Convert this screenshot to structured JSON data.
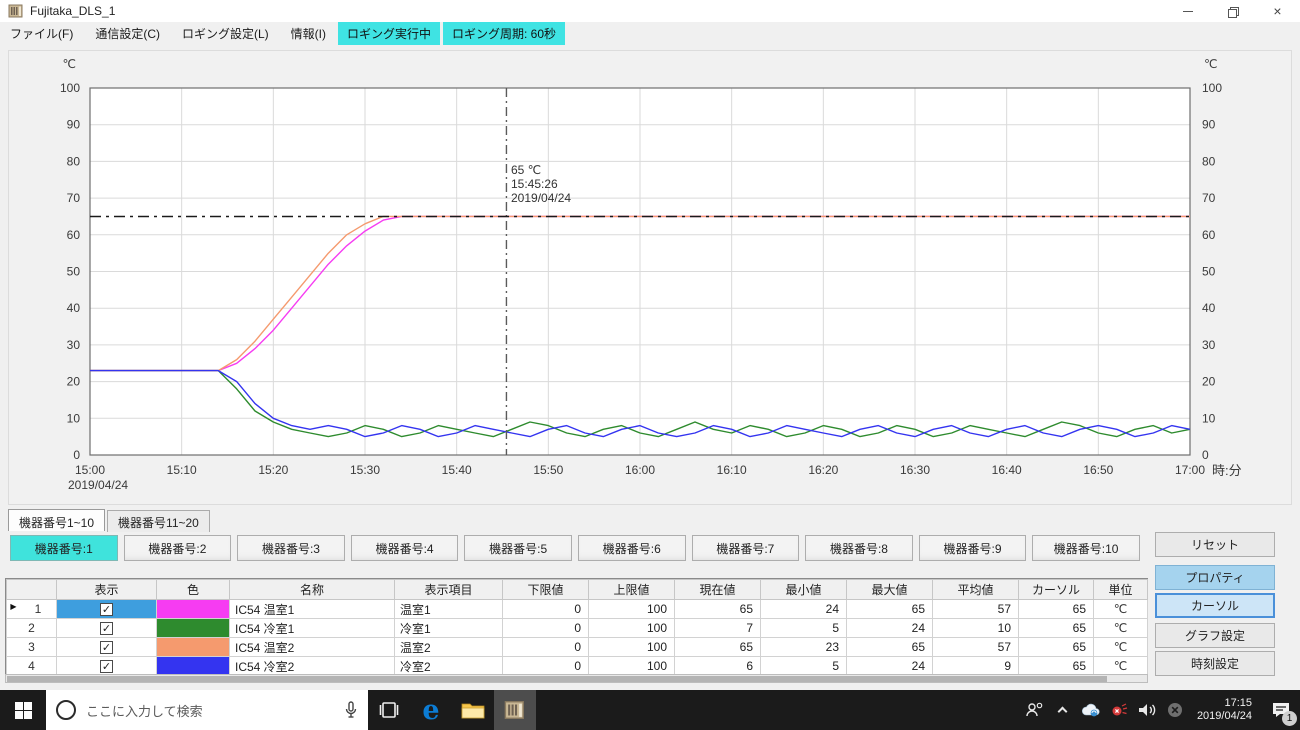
{
  "window": {
    "title": "Fujitaka_DLS_1",
    "controls": [
      "minimize",
      "restore",
      "close"
    ]
  },
  "menu": {
    "items": [
      "ファイル(F)",
      "通信設定(C)",
      "ロギング設定(L)",
      "情報(I)"
    ],
    "status_items": [
      "ロギング実行中",
      "ロギング周期: 60秒"
    ],
    "status_color": "#3fe3e3"
  },
  "chart_data": {
    "type": "line",
    "y_unit_left": "℃",
    "y_unit_right": "℃",
    "xlabel": "時:分",
    "x_date_label": "2019/04/24",
    "ylim": [
      0,
      100
    ],
    "yticks": [
      0,
      10,
      20,
      30,
      40,
      50,
      60,
      70,
      80,
      90,
      100
    ],
    "xtick_minutes": [
      0,
      10,
      20,
      30,
      40,
      50,
      60,
      70,
      80,
      90,
      100,
      110,
      120
    ],
    "xtick_labels": [
      "15:00",
      "15:10",
      "15:20",
      "15:30",
      "15:40",
      "15:50",
      "16:00",
      "16:10",
      "16:20",
      "16:30",
      "16:40",
      "16:50",
      "17:00"
    ],
    "grid": true,
    "x_step_minutes": 2,
    "cursor": {
      "minutes": 45.43,
      "y_value": 65,
      "value_label": "65 ℃",
      "time_label": "15:45:26",
      "date_label": "2019/04/24"
    },
    "series": [
      {
        "name": "IC54 温室1",
        "color": "#f63cf2",
        "values": [
          23,
          23,
          23,
          23,
          23,
          23,
          23,
          23,
          25,
          29,
          34,
          40,
          46,
          52,
          57,
          61,
          64,
          65,
          65,
          65,
          65,
          65,
          65,
          65,
          65,
          65,
          65,
          65,
          65,
          65,
          65,
          65,
          65,
          65,
          65,
          65,
          65,
          65,
          65,
          65,
          65,
          65,
          65,
          65,
          65,
          65,
          65,
          65,
          65,
          65,
          65,
          65,
          65,
          65,
          65,
          65,
          65,
          65,
          65,
          65,
          65
        ]
      },
      {
        "name": "IC54 冷室1",
        "color": "#2e8b2e",
        "values": [
          23,
          23,
          23,
          23,
          23,
          23,
          23,
          23,
          18,
          12,
          9,
          7,
          6,
          5,
          6,
          8,
          7,
          5,
          6,
          8,
          7,
          6,
          5,
          7,
          9,
          8,
          6,
          5,
          7,
          8,
          6,
          5,
          7,
          9,
          7,
          6,
          8,
          7,
          5,
          6,
          8,
          7,
          5,
          6,
          8,
          7,
          5,
          6,
          8,
          7,
          6,
          5,
          7,
          9,
          8,
          6,
          5,
          7,
          8,
          6,
          7
        ]
      },
      {
        "name": "IC54 温室2",
        "color": "#f59a6e",
        "values": [
          23,
          23,
          23,
          23,
          23,
          23,
          23,
          23,
          26,
          31,
          37,
          43,
          49,
          55,
          60,
          63,
          65,
          65,
          65,
          65,
          65,
          65,
          65,
          65,
          65,
          65,
          65,
          65,
          65,
          65,
          65,
          65,
          65,
          65,
          65,
          65,
          65,
          65,
          65,
          65,
          65,
          65,
          65,
          65,
          65,
          65,
          65,
          65,
          65,
          65,
          65,
          65,
          65,
          65,
          65,
          65,
          65,
          65,
          65,
          65,
          65
        ]
      },
      {
        "name": "IC54 冷室2",
        "color": "#3434f0",
        "values": [
          23,
          23,
          23,
          23,
          23,
          23,
          23,
          23,
          20,
          14,
          10,
          8,
          7,
          8,
          7,
          5,
          6,
          8,
          7,
          5,
          6,
          8,
          7,
          6,
          5,
          7,
          8,
          6,
          5,
          7,
          8,
          6,
          5,
          6,
          8,
          7,
          5,
          6,
          8,
          7,
          6,
          5,
          7,
          8,
          6,
          5,
          7,
          8,
          6,
          5,
          7,
          8,
          6,
          5,
          7,
          8,
          7,
          5,
          6,
          8,
          7
        ]
      }
    ]
  },
  "tabs": [
    {
      "label": "機器番号1~10",
      "active": true
    },
    {
      "label": "機器番号11~20",
      "active": false
    }
  ],
  "device_buttons": [
    {
      "label": "機器番号:1",
      "active": true
    },
    {
      "label": "機器番号:2",
      "active": false
    },
    {
      "label": "機器番号:3",
      "active": false
    },
    {
      "label": "機器番号:4",
      "active": false
    },
    {
      "label": "機器番号:5",
      "active": false
    },
    {
      "label": "機器番号:6",
      "active": false
    },
    {
      "label": "機器番号:7",
      "active": false
    },
    {
      "label": "機器番号:8",
      "active": false
    },
    {
      "label": "機器番号:9",
      "active": false
    },
    {
      "label": "機器番号:10",
      "active": false
    }
  ],
  "side_buttons": [
    {
      "label": "リセット",
      "variant": "default"
    },
    {
      "label": "プロパティ",
      "variant": "hover"
    },
    {
      "label": "カーソル",
      "variant": "active"
    },
    {
      "label": "グラフ設定",
      "variant": "default"
    },
    {
      "label": "時刻設定",
      "variant": "default"
    }
  ],
  "table": {
    "headers": [
      "表示",
      "色",
      "名称",
      "表示項目",
      "下限値",
      "上限値",
      "現在値",
      "最小値",
      "最大値",
      "平均値",
      "カーソル",
      "単位"
    ],
    "rows": [
      {
        "no": "1",
        "selected": true,
        "checked": true,
        "color": "#f63cf2",
        "name": "IC54 温室1",
        "item": "温室1",
        "lower": "0",
        "upper": "100",
        "current": "65",
        "min": "24",
        "max": "65",
        "avg": "57",
        "cursor": "65",
        "unit": "℃"
      },
      {
        "no": "2",
        "selected": false,
        "checked": true,
        "color": "#2e8b2e",
        "name": "IC54 冷室1",
        "item": "冷室1",
        "lower": "0",
        "upper": "100",
        "current": "7",
        "min": "5",
        "max": "24",
        "avg": "10",
        "cursor": "65",
        "unit": "℃"
      },
      {
        "no": "3",
        "selected": false,
        "checked": true,
        "color": "#f59a6e",
        "name": "IC54 温室2",
        "item": "温室2",
        "lower": "0",
        "upper": "100",
        "current": "65",
        "min": "23",
        "max": "65",
        "avg": "57",
        "cursor": "65",
        "unit": "℃"
      },
      {
        "no": "4",
        "selected": false,
        "checked": true,
        "color": "#3434f0",
        "name": "IC54 冷室2",
        "item": "冷室2",
        "lower": "0",
        "upper": "100",
        "current": "6",
        "min": "5",
        "max": "24",
        "avg": "9",
        "cursor": "65",
        "unit": "℃"
      }
    ]
  },
  "taskbar": {
    "search_placeholder": "ここに入力して検索",
    "clock_time": "17:15",
    "clock_date": "2019/04/24",
    "action_center_badge": "1"
  }
}
